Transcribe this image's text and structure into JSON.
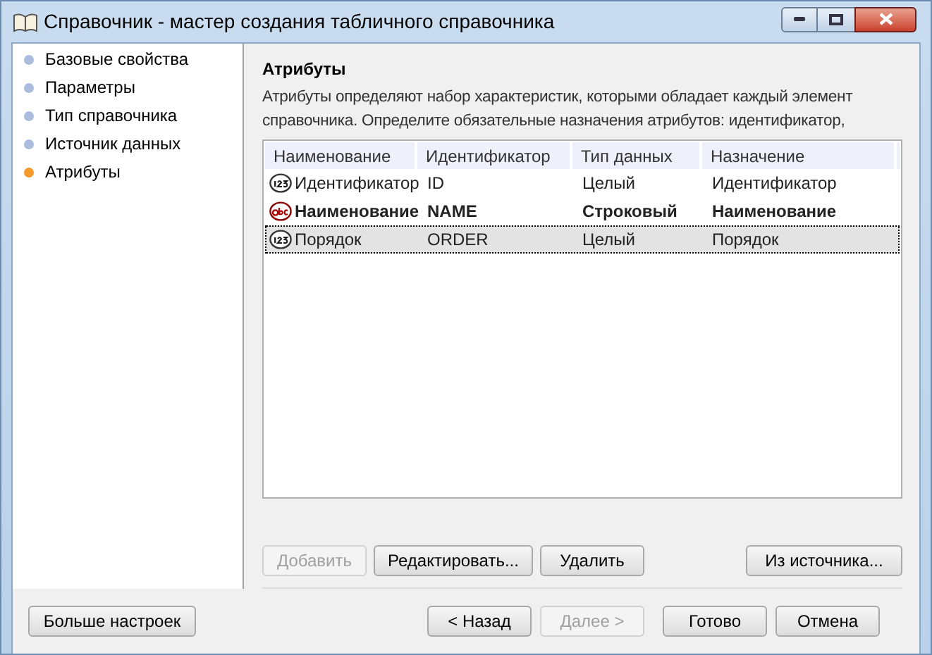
{
  "window": {
    "title": "Справочник - мастер создания табличного справочника"
  },
  "steps": [
    {
      "label": "Базовые свойства",
      "selected": false
    },
    {
      "label": "Параметры",
      "selected": false
    },
    {
      "label": "Тип справочника",
      "selected": false
    },
    {
      "label": "Источник данных",
      "selected": false
    },
    {
      "label": "Атрибуты",
      "selected": true
    }
  ],
  "page": {
    "heading": "Атрибуты",
    "description": "Атрибуты определяют набор характеристик, которыми обладает каждый элемент справочника. Определите обязательные назначения атрибутов: идентификатор,"
  },
  "table": {
    "columns": [
      "Наименование",
      "Идентификатор",
      "Тип данных",
      "Назначение"
    ],
    "rows": [
      {
        "kind": "number",
        "bold": false,
        "selected": false,
        "cells": [
          "Идентификатор",
          "ID",
          "Целый",
          "Идентификатор"
        ]
      },
      {
        "kind": "text",
        "bold": true,
        "selected": false,
        "cells": [
          "Наименование",
          "NAME",
          "Строковый",
          "Наименование"
        ]
      },
      {
        "kind": "number",
        "bold": false,
        "selected": true,
        "cells": [
          "Порядок",
          "ORDER",
          "Целый",
          "Порядок"
        ]
      }
    ]
  },
  "table_buttons": [
    {
      "label": "Добавить",
      "disabled": true
    },
    {
      "label": "Редактировать...",
      "disabled": false
    },
    {
      "label": "Удалить",
      "disabled": false
    },
    {
      "label": "Из источника...",
      "disabled": false
    }
  ],
  "footer_buttons": [
    {
      "label": "Больше настроек",
      "disabled": false
    },
    {
      "label": "< Назад",
      "disabled": false
    },
    {
      "label": "Далее >",
      "disabled": true
    },
    {
      "label": "Готово",
      "disabled": false
    },
    {
      "label": "Отмена",
      "disabled": false
    }
  ]
}
